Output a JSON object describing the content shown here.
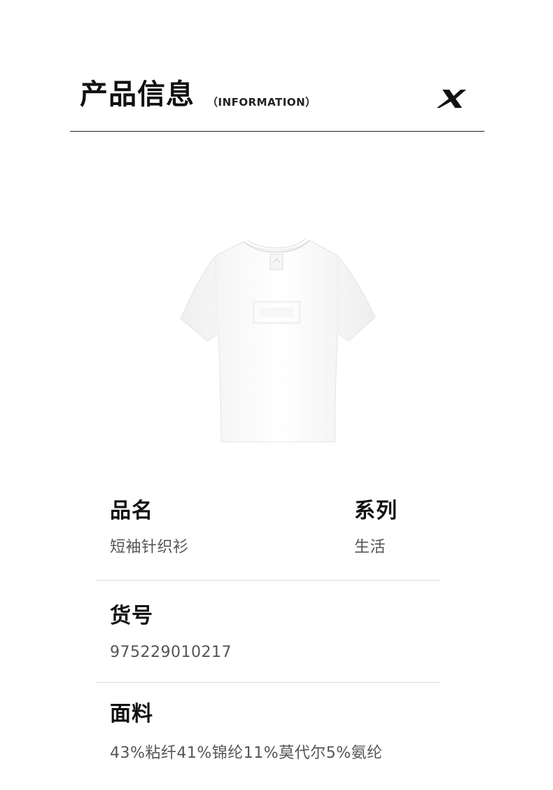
{
  "header": {
    "title": "产品信息",
    "subtitle": "（INFORMATION）",
    "logo_icon": "xtep-brand-x-logo-icon"
  },
  "product_image": {
    "icon": "white-tshirt-image",
    "color": "#ffffff"
  },
  "info": {
    "name": {
      "label": "品名",
      "value": "短袖针织衫"
    },
    "series": {
      "label": "系列",
      "value": "生活"
    },
    "sku": {
      "label": "货号",
      "value": "975229010217"
    },
    "fabric": {
      "label": "面料",
      "value": "43%粘纤41%锦纶11%莫代尔5%氨纶"
    }
  },
  "colors": {
    "label": "#111111",
    "value": "#555555",
    "divider": "#dddddd",
    "header_rule": "#222222"
  }
}
